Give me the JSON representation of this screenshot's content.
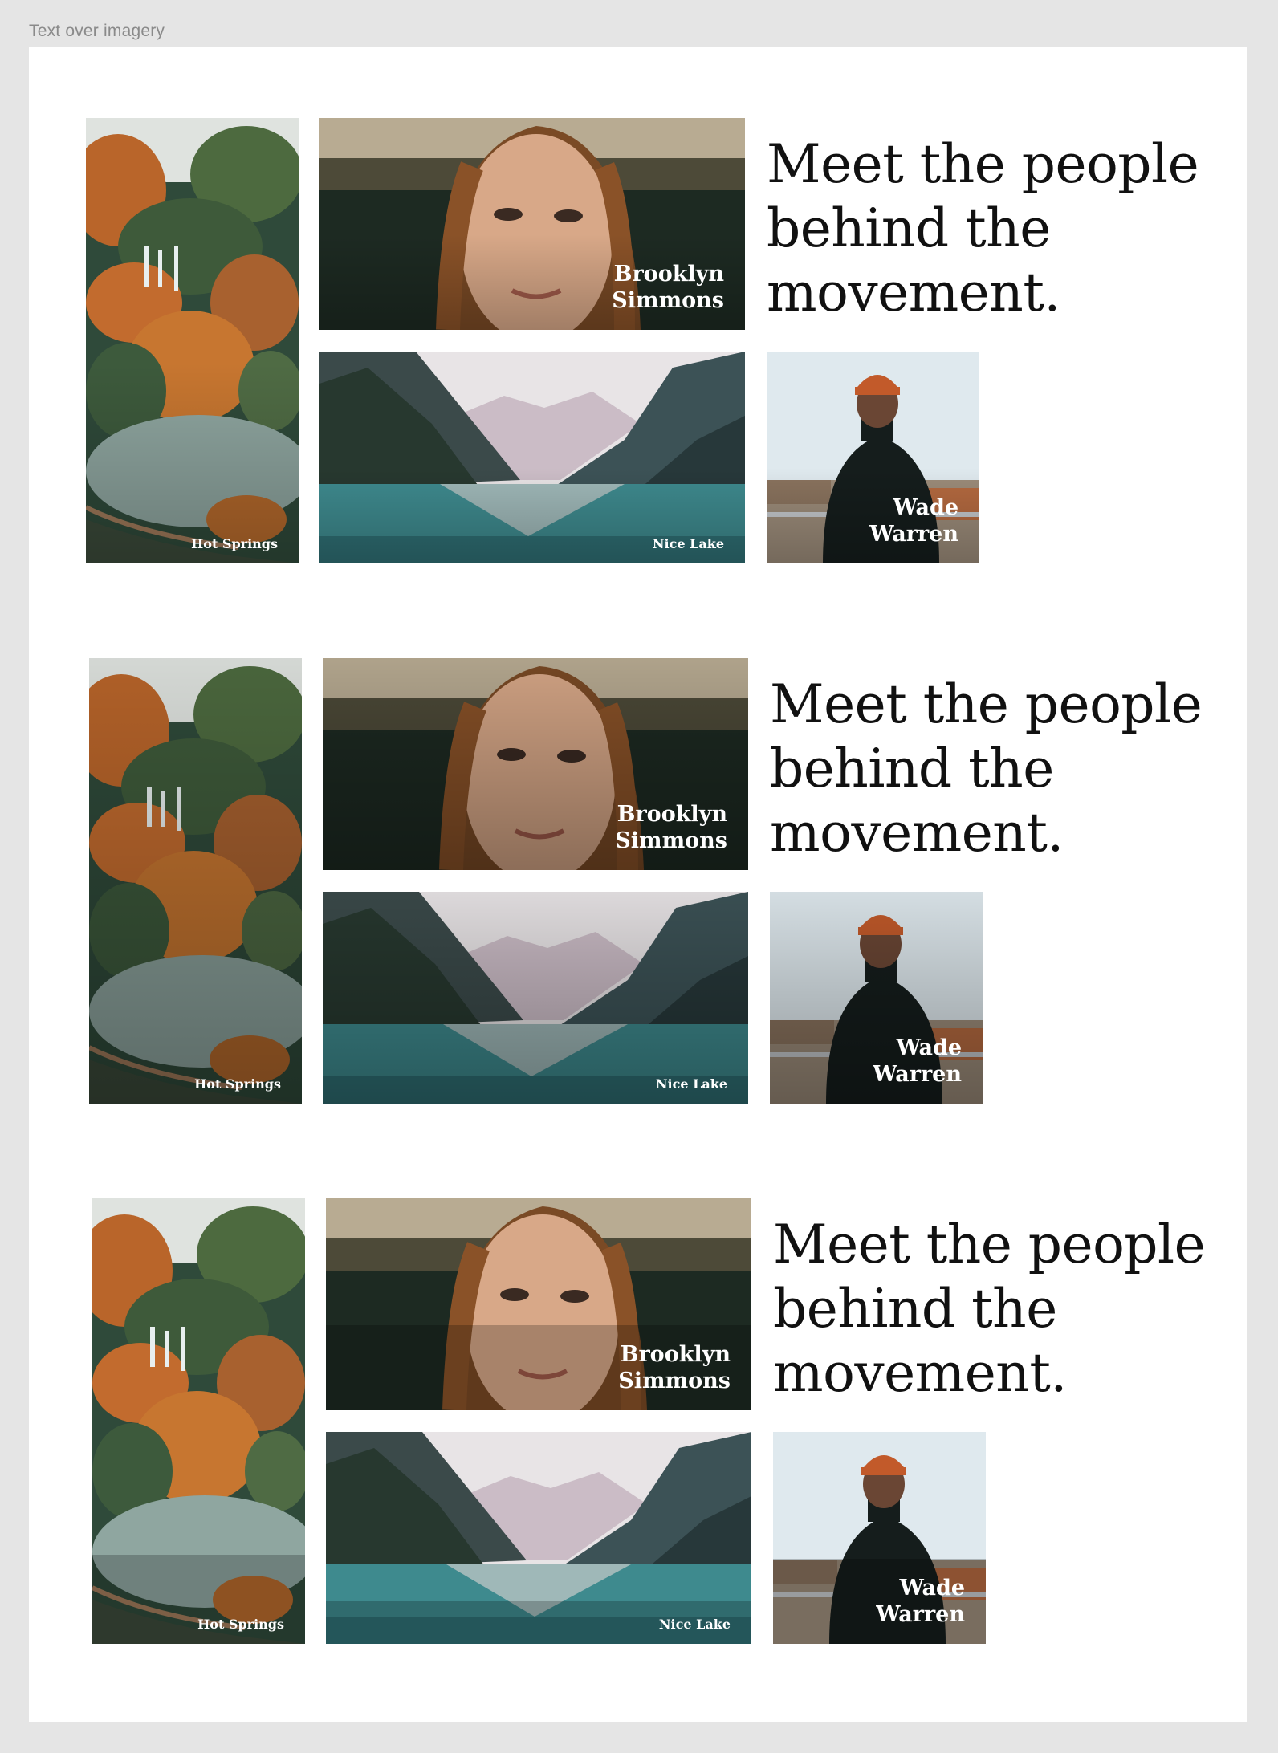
{
  "frame": {
    "label": "Text over imagery"
  },
  "sections": [
    {
      "variant": "v1",
      "headline": "Meet the people behind the movement.",
      "cards": {
        "springs": "Hot Springs",
        "woman": "Brooklyn Simmons",
        "lake": "Nice Lake",
        "man": "Wade Warren"
      }
    },
    {
      "variant": "v2",
      "headline": "Meet the people behind the movement.",
      "cards": {
        "springs": "Hot Springs",
        "woman": "Brooklyn Simmons",
        "lake": "Nice Lake",
        "man": "Wade Warren"
      }
    },
    {
      "variant": "v3",
      "headline": "Meet the people behind the movement.",
      "cards": {
        "springs": "Hot Springs",
        "woman": "Brooklyn Simmons",
        "lake": "Nice Lake",
        "man": "Wade Warren"
      }
    }
  ],
  "colors": {
    "canvas": "#e5e5e5",
    "frame": "#ffffff",
    "headline": "#111111",
    "caption": "#ffffff",
    "label": "#8a8a8a"
  }
}
